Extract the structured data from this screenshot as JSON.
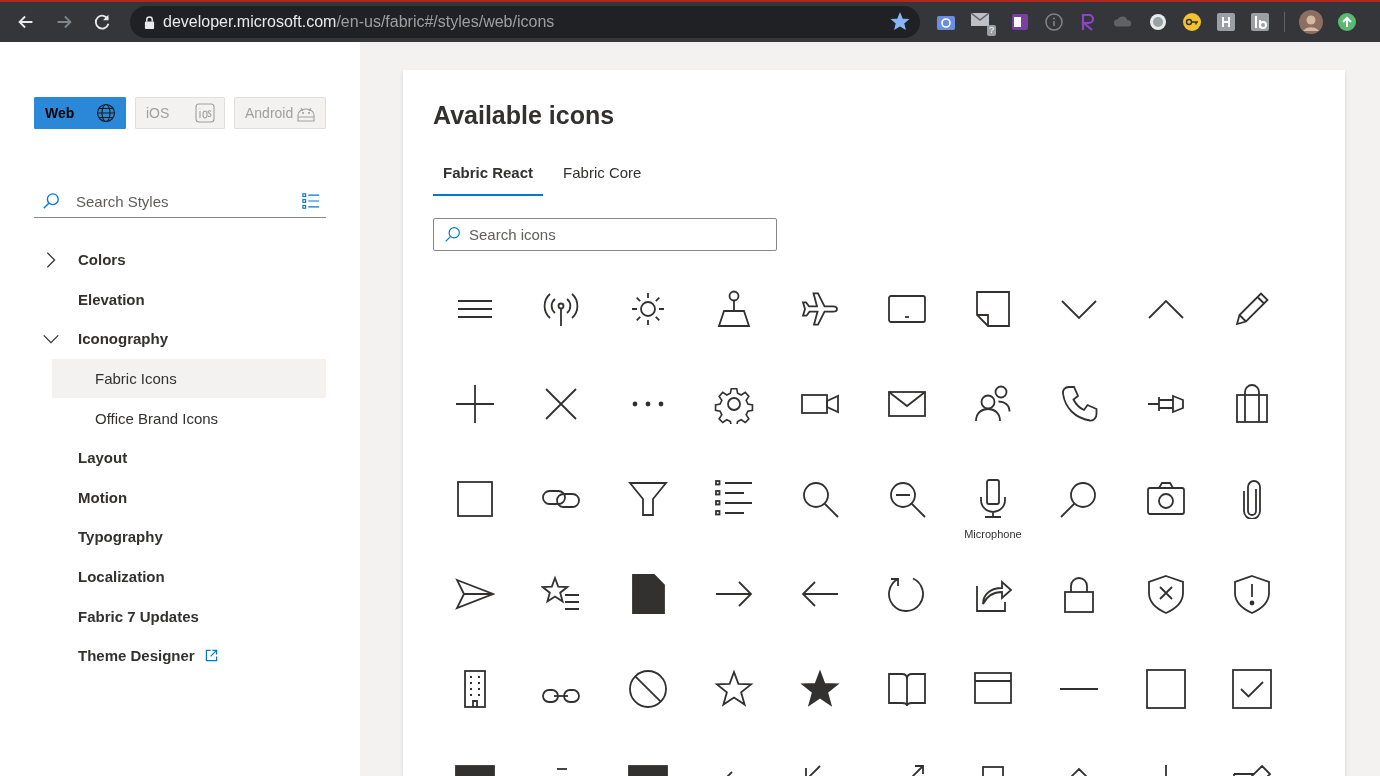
{
  "browser": {
    "nav_buttons": [
      {
        "kind": "back",
        "disabled": false
      },
      {
        "kind": "forward",
        "disabled": true
      },
      {
        "kind": "reload",
        "disabled": false
      }
    ],
    "url_host": "developer.microsoft.com",
    "url_path": "/en-us/fabric#/styles/web/icons",
    "bookmarked": true,
    "extension_badge": "?"
  },
  "sidebar": {
    "platforms": [
      {
        "kind": "web",
        "label": "Web",
        "selected": true
      },
      {
        "kind": "ios",
        "label": "iOS",
        "selected": false
      },
      {
        "kind": "android",
        "label": "Android",
        "selected": false
      }
    ],
    "search": {
      "placeholder": "Search Styles"
    },
    "nav": [
      {
        "kind": "group",
        "label": "Colors",
        "expanded": false,
        "selected": false
      },
      {
        "kind": "page",
        "label": "Elevation",
        "selected": false
      },
      {
        "kind": "group",
        "label": "Iconography",
        "expanded": true,
        "selected": false,
        "children": [
          {
            "label": "Fabric Icons",
            "selected": true
          },
          {
            "label": "Office Brand Icons",
            "selected": false
          }
        ]
      },
      {
        "kind": "page",
        "label": "Layout",
        "selected": false
      },
      {
        "kind": "page",
        "label": "Motion",
        "selected": false
      },
      {
        "kind": "page",
        "label": "Typography",
        "selected": false
      },
      {
        "kind": "page",
        "label": "Localization",
        "selected": false
      },
      {
        "kind": "page",
        "label": "Fabric 7 Updates",
        "selected": false
      },
      {
        "kind": "external",
        "label": "Theme Designer",
        "selected": false
      }
    ]
  },
  "main": {
    "title": "Available icons",
    "tabs": [
      {
        "label": "Fabric React",
        "selected": true
      },
      {
        "label": "Fabric Core",
        "selected": false
      }
    ],
    "search": {
      "placeholder": "Search icons"
    },
    "tooltip": {
      "text": "Microphone"
    }
  }
}
